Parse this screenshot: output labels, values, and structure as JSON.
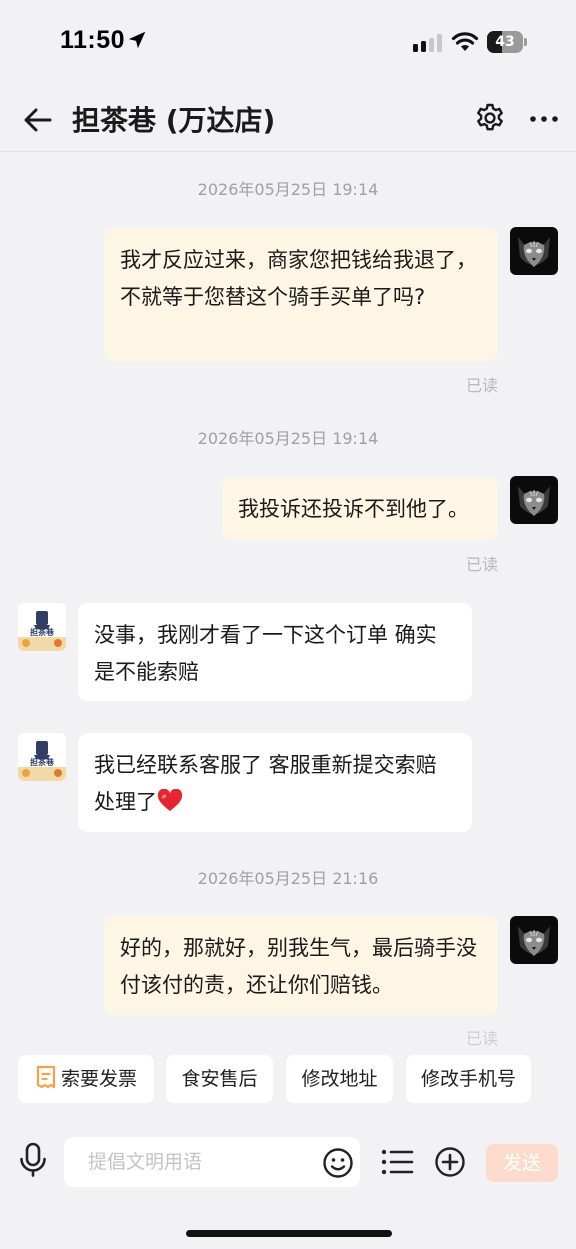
{
  "status_bar": {
    "time": "11:50",
    "battery_text": "43",
    "battery_level": 0.43
  },
  "header": {
    "title": "担茶巷 (万达店)"
  },
  "messages": [
    {
      "timestamp": "2026年05月25日 19:14",
      "direction": "outgoing",
      "text": "我才反应过来，商家您把钱给我退了，不就等于您替这个骑手买单了吗?",
      "read_status": "已读"
    },
    {
      "timestamp": "2026年05月25日 19:14",
      "direction": "outgoing",
      "text": "我投诉还投诉不到他了。",
      "read_status": "已读"
    },
    {
      "direction": "incoming",
      "text": "没事，我刚才看了一下这个订单 确实是不能索赔"
    },
    {
      "direction": "incoming",
      "text": "我已经联系客服了 客服重新提交索赔处理了"
    },
    {
      "timestamp": "2026年05月25日 21:16",
      "direction": "outgoing",
      "text": "好的，那就好，别我生气，最后骑手没付该付的责，还让你们赔钱。",
      "read_status": "已读"
    }
  ],
  "quick_actions": [
    {
      "label": "索要发票",
      "icon": "invoice-icon"
    },
    {
      "label": "食安售后"
    },
    {
      "label": "修改地址"
    },
    {
      "label": "修改手机号"
    }
  ],
  "input_bar": {
    "placeholder": "提倡文明用语",
    "send_label": "发送"
  },
  "shop_avatar": {
    "text": "担茶巷"
  },
  "colors": {
    "outgoing_bubble": "#fdf6e5",
    "incoming_bubble": "#ffffff",
    "send_button": "#fbdccc",
    "accent_orange": "#f5a04a"
  }
}
